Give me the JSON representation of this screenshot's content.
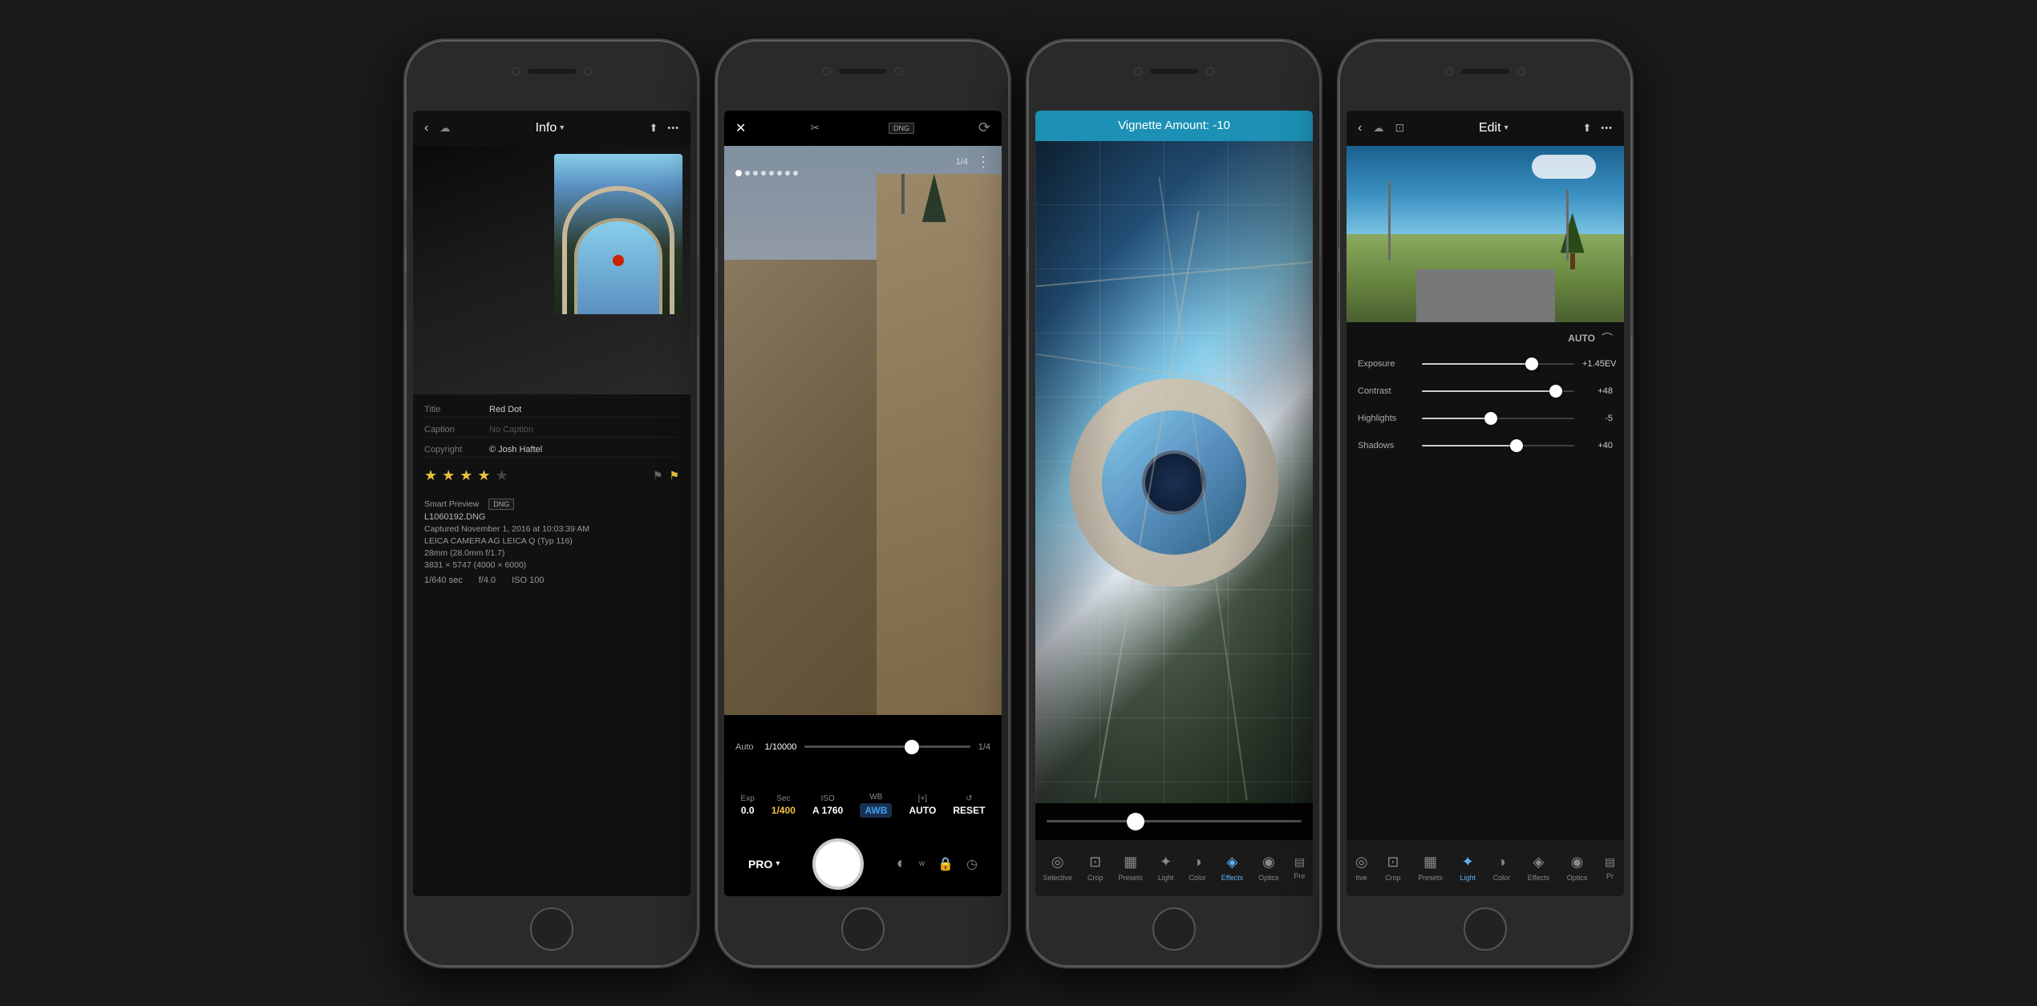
{
  "phones": [
    {
      "id": "phone1",
      "header": {
        "back_icon": "‹",
        "cloud_icon": "☁",
        "title": "Info",
        "chevron": "▾",
        "share_icon": "⬆",
        "more_icon": "•••"
      },
      "photo": {
        "has_thumbnail": true
      },
      "metadata": {
        "title_label": "Title",
        "title_value": "Red Dot",
        "caption_label": "Caption",
        "caption_value": "No Caption",
        "copyright_label": "Copyright",
        "copyright_value": "© Josh Haftel"
      },
      "stars": {
        "filled": 4,
        "empty": 1,
        "total": 5
      },
      "smart_preview": "Smart Preview",
      "dng_badge": "DNG",
      "filename": "L1060192.DNG",
      "captured": "Captured November 1, 2016 at 10:03:39 AM",
      "camera": "LEICA CAMERA AG LEICA Q (Typ 116)",
      "lens": "28mm (28.0mm f/1.7)",
      "dimensions": "3831 × 5747 (4000 × 6000)",
      "shutter": "1/640 sec",
      "aperture": "f/4.0",
      "iso": "ISO 100"
    },
    {
      "id": "phone2",
      "header": {
        "close_icon": "✕",
        "scissors_icon": "✂",
        "dng_badge": "DNG",
        "flip_icon": "⟳"
      },
      "viewfinder": {
        "counter": "1/4",
        "more_icon": "⋮"
      },
      "controls_top": {
        "auto_label": "Auto",
        "shutter_speed": "1/10000",
        "fraction": "1/4"
      },
      "slider": {
        "scroll_dots": 8
      },
      "controls_bottom": {
        "items": [
          {
            "label": "Exp",
            "value": "0.0"
          },
          {
            "label": "Sec",
            "value": "1/400",
            "active": true
          },
          {
            "label": "ISO",
            "value": "A 1760"
          },
          {
            "label": "WB",
            "value": "AWB",
            "type": "blue"
          },
          {
            "label": "[+]",
            "value": "AUTO"
          },
          {
            "label": "↺",
            "value": "RESET"
          }
        ]
      },
      "shutter_area": {
        "pro_label": "PRO",
        "chevron": "▾"
      }
    },
    {
      "id": "phone3",
      "header_bar": {
        "label": "Vignette Amount: -10"
      },
      "toolbar": {
        "items": [
          {
            "label": "Selective",
            "icon": "◎",
            "active": false
          },
          {
            "label": "Crop",
            "icon": "⊡",
            "active": false
          },
          {
            "label": "Presets",
            "icon": "▦",
            "active": false
          },
          {
            "label": "Light",
            "icon": "✦",
            "active": false
          },
          {
            "label": "Color",
            "icon": "◑",
            "active": false
          },
          {
            "label": "Effects",
            "icon": "◈",
            "active": true
          },
          {
            "label": "Optics",
            "icon": "◉",
            "active": false
          },
          {
            "label": "Pre",
            "icon": "▤",
            "active": false
          }
        ]
      }
    },
    {
      "id": "phone4",
      "header": {
        "back_icon": "‹",
        "cloud_icon": "☁",
        "crop_icon": "⊡",
        "title": "Edit",
        "chevron": "▾",
        "share_icon": "⬆",
        "more_icon": "•••"
      },
      "controls": {
        "auto_btn": "AUTO",
        "sliders": [
          {
            "name": "Exposure",
            "value": "+1.45EV",
            "fill_pct": 72
          },
          {
            "name": "Contrast",
            "value": "+48",
            "fill_pct": 88
          },
          {
            "name": "Highlights",
            "value": "-5",
            "fill_pct": 45
          },
          {
            "name": "Shadows",
            "value": "+40",
            "fill_pct": 62
          }
        ]
      },
      "toolbar": {
        "items": [
          {
            "label": "tive",
            "icon": "◎",
            "active": false
          },
          {
            "label": "Crop",
            "icon": "⊡",
            "active": false
          },
          {
            "label": "Presets",
            "icon": "▦",
            "active": false
          },
          {
            "label": "Light",
            "icon": "✦",
            "active": true
          },
          {
            "label": "Color",
            "icon": "◑",
            "active": false
          },
          {
            "label": "Effects",
            "icon": "◈",
            "active": false
          },
          {
            "label": "Optics",
            "icon": "◉",
            "active": false
          },
          {
            "label": "Pr",
            "icon": "▤",
            "active": false
          }
        ]
      }
    }
  ]
}
